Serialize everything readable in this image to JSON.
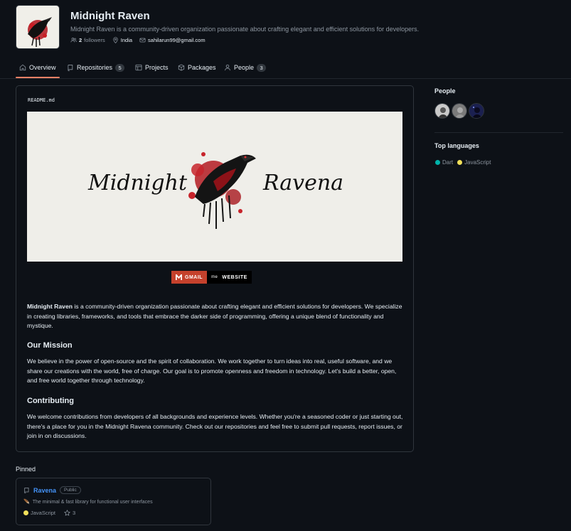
{
  "org": {
    "name": "Midnight Raven",
    "description": "Midnight Raven is a community-driven organization passionate about crafting elegant and efficient solutions for developers.",
    "followers_count": "2",
    "followers_label": "followers",
    "location": "India",
    "email": "sahilarun99@gmail.com"
  },
  "nav": {
    "tabs": [
      {
        "label": "Overview",
        "icon": "book-icon",
        "active": true
      },
      {
        "label": "Repositories",
        "icon": "repo-icon",
        "count": "5"
      },
      {
        "label": "Projects",
        "icon": "table-icon"
      },
      {
        "label": "Packages",
        "icon": "package-icon"
      },
      {
        "label": "People",
        "icon": "person-icon",
        "count": "3"
      }
    ]
  },
  "readme": {
    "filename": "README.md",
    "banner_text_left": "Midnight",
    "banner_text_right": "Ravena",
    "badges": {
      "gmail": "GMAIL",
      "website_prefix": "me",
      "website": "WEBSITE"
    },
    "intro_bold": "Midnight Raven",
    "intro_rest": " is a community-driven organization passionate about crafting elegant and efficient solutions for developers. We specialize in creating libraries, frameworks, and tools that embrace the darker side of programming, offering a unique blend of functionality and mystique.",
    "mission_heading": "Our Mission",
    "mission_text": "We believe in the power of open-source and the spirit of collaboration. We work together to turn ideas into real, useful software, and we share our creations with the world, free of charge. Our goal is to promote openness and freedom in technology. Let's build a better, open, and free world together through technology.",
    "contrib_heading": "Contributing",
    "contrib_text": "We welcome contributions from developers of all backgrounds and experience levels. Whether you're a seasoned coder or just starting out, there's a place for you in the Midnight Ravena community. Check out our repositories and feel free to submit pull requests, report issues, or join in on discussions."
  },
  "sidebar": {
    "people_title": "People",
    "languages_title": "Top languages",
    "languages": [
      {
        "name": "Dart",
        "color": "#00b4ab"
      },
      {
        "name": "JavaScript",
        "color": "#f1e05a"
      }
    ]
  },
  "pinned": {
    "title": "Pinned",
    "repo": {
      "name": "Ravena",
      "visibility": "Public",
      "emoji": "🪶",
      "description": "The minimal & fast library for functional user interfaces",
      "language": "JavaScript",
      "language_color": "#f1e05a",
      "stars": "3"
    }
  },
  "colors": {
    "accent_underline": "#f78166",
    "link": "#4493f8",
    "background": "#0d1117"
  }
}
